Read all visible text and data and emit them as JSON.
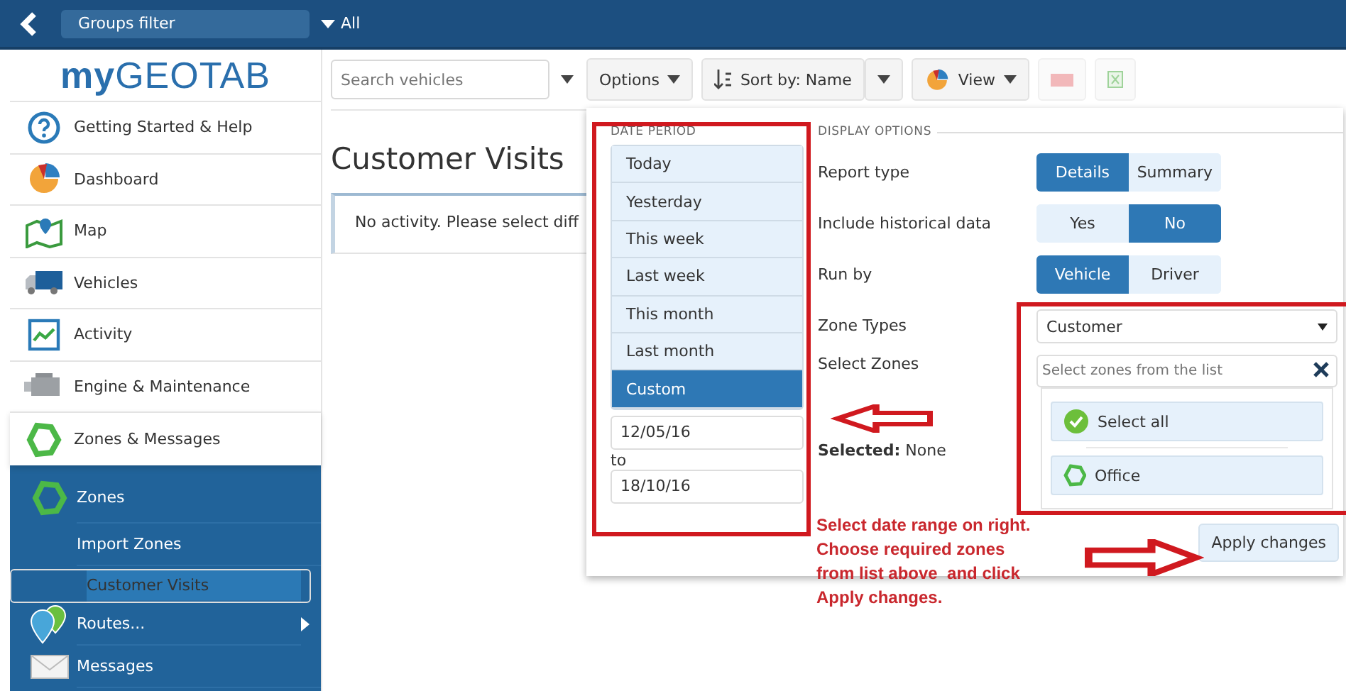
{
  "top_bar": {
    "groups_filter": "Groups filter",
    "filter_value": "All"
  },
  "logo": {
    "prefix": "my",
    "name": "GEOTAB"
  },
  "sidebar": {
    "items": [
      {
        "label": "Getting Started & Help",
        "kind": "help",
        "expanded": false
      },
      {
        "label": "Dashboard",
        "kind": "dashboard",
        "expanded": false
      },
      {
        "label": "Map",
        "kind": "map",
        "expanded": false
      },
      {
        "label": "Vehicles",
        "kind": "vehicles",
        "expanded": false
      },
      {
        "label": "Activity",
        "kind": "activity",
        "expanded": false
      },
      {
        "label": "Engine & Maintenance",
        "kind": "engine",
        "expanded": false
      },
      {
        "label": "Zones & Messages",
        "kind": "zones",
        "expanded": true,
        "children": [
          {
            "label": "Zones",
            "kind": "zones",
            "selected": false
          },
          {
            "label": "Import Zones",
            "kind": "none",
            "selected": false
          },
          {
            "label": "Customer Visits",
            "kind": "none",
            "selected": true
          },
          {
            "label": "Routes...",
            "kind": "routes",
            "selected": false,
            "submenu": true
          },
          {
            "label": "Messages",
            "kind": "messages",
            "selected": false
          }
        ]
      }
    ]
  },
  "toolbar": {
    "search_placeholder": "Search vehicles",
    "options": "Options",
    "sort": "Sort by: Name",
    "view": "View"
  },
  "page": {
    "title": "Customer Visits",
    "message": "No activity. Please select diff"
  },
  "options_panel": {
    "date_period": {
      "title": "DATE PERIOD",
      "options": [
        {
          "label": "Today",
          "selected": false
        },
        {
          "label": "Yesterday",
          "selected": false
        },
        {
          "label": "This week",
          "selected": false
        },
        {
          "label": "Last week",
          "selected": false
        },
        {
          "label": "This month",
          "selected": false
        },
        {
          "label": "Last month",
          "selected": false
        },
        {
          "label": "Custom",
          "selected": true
        }
      ],
      "from": "12/05/16",
      "to_label": "to",
      "to": "18/10/16"
    },
    "display_options": {
      "title": "DISPLAY OPTIONS",
      "toggles": [
        {
          "label": "Report type",
          "options": [
            {
              "label": "Details",
              "selected": true
            },
            {
              "label": "Summary",
              "selected": false
            }
          ]
        },
        {
          "label": "Include historical data",
          "options": [
            {
              "label": "Yes",
              "selected": false
            },
            {
              "label": "No",
              "selected": true
            }
          ]
        },
        {
          "label": "Run by",
          "options": [
            {
              "label": "Vehicle",
              "selected": true
            },
            {
              "label": "Driver",
              "selected": false
            }
          ]
        }
      ],
      "zone_types": {
        "label": "Zone Types",
        "value": "Customer"
      },
      "select_zones": {
        "label": "Select Zones",
        "placeholder": "Select zones from the list",
        "items": [
          {
            "label": "Select all",
            "kind": "select-all"
          },
          {
            "label": "Office",
            "kind": "zone"
          }
        ]
      },
      "selected_text": "**Selected:** None"
    },
    "apply": "Apply changes"
  },
  "annotation": {
    "text": "Select date range on right.\nChoose required zones\nfrom list above  and click\nApply changes."
  }
}
